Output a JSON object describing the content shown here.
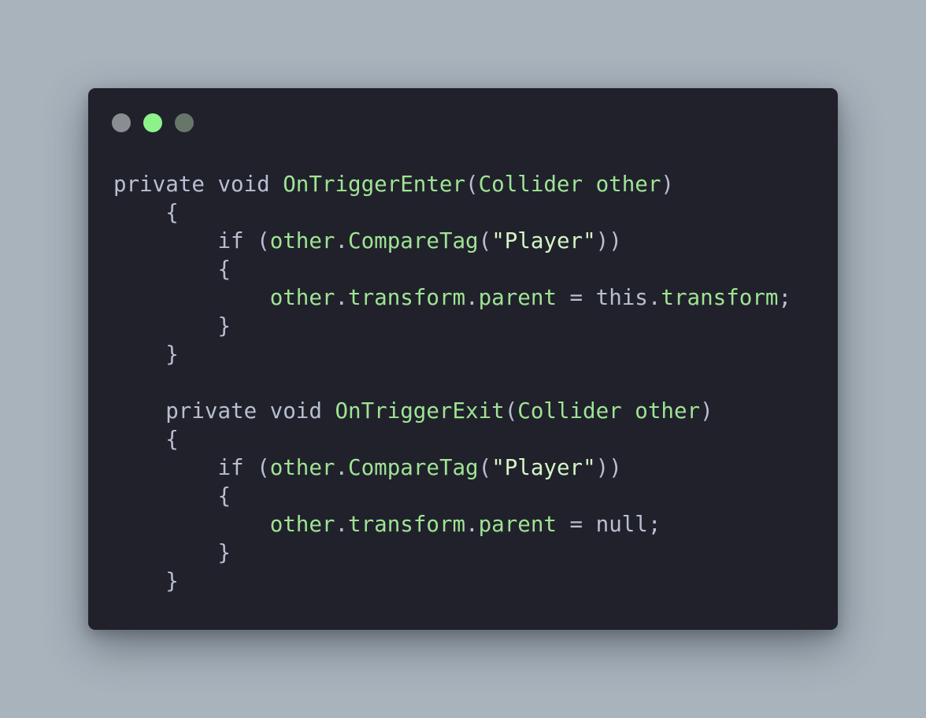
{
  "window": {
    "dots": [
      {
        "name": "close",
        "color": "#8a8d91"
      },
      {
        "name": "minimize",
        "color": "#8ef28b"
      },
      {
        "name": "zoom",
        "color": "#66776a"
      }
    ]
  },
  "code": {
    "lines": [
      [
        {
          "t": "private void ",
          "k": "text"
        },
        {
          "t": "OnTriggerEnter",
          "k": "green"
        },
        {
          "t": "(",
          "k": "text"
        },
        {
          "t": "Collider other",
          "k": "green"
        },
        {
          "t": ")",
          "k": "text"
        }
      ],
      [
        {
          "t": "    {",
          "k": "text"
        }
      ],
      [
        {
          "t": "        if (",
          "k": "text"
        },
        {
          "t": "other",
          "k": "green"
        },
        {
          "t": ".",
          "k": "text"
        },
        {
          "t": "CompareTag",
          "k": "green"
        },
        {
          "t": "(",
          "k": "text"
        },
        {
          "t": "\"Player\"",
          "k": "string"
        },
        {
          "t": "))",
          "k": "text"
        }
      ],
      [
        {
          "t": "        {",
          "k": "text"
        }
      ],
      [
        {
          "t": "            ",
          "k": "text"
        },
        {
          "t": "other",
          "k": "green"
        },
        {
          "t": ".",
          "k": "text"
        },
        {
          "t": "transform",
          "k": "green"
        },
        {
          "t": ".",
          "k": "text"
        },
        {
          "t": "parent",
          "k": "green"
        },
        {
          "t": " = this.",
          "k": "text"
        },
        {
          "t": "transform",
          "k": "green"
        },
        {
          "t": ";",
          "k": "text"
        }
      ],
      [
        {
          "t": "        }",
          "k": "text"
        }
      ],
      [
        {
          "t": "    }",
          "k": "text"
        }
      ],
      [
        {
          "t": "",
          "k": "text"
        }
      ],
      [
        {
          "t": "    private void ",
          "k": "text"
        },
        {
          "t": "OnTriggerExit",
          "k": "green"
        },
        {
          "t": "(",
          "k": "text"
        },
        {
          "t": "Collider other",
          "k": "green"
        },
        {
          "t": ")",
          "k": "text"
        }
      ],
      [
        {
          "t": "    {",
          "k": "text"
        }
      ],
      [
        {
          "t": "        if (",
          "k": "text"
        },
        {
          "t": "other",
          "k": "green"
        },
        {
          "t": ".",
          "k": "text"
        },
        {
          "t": "CompareTag",
          "k": "green"
        },
        {
          "t": "(",
          "k": "text"
        },
        {
          "t": "\"Player\"",
          "k": "string"
        },
        {
          "t": "))",
          "k": "text"
        }
      ],
      [
        {
          "t": "        {",
          "k": "text"
        }
      ],
      [
        {
          "t": "            ",
          "k": "text"
        },
        {
          "t": "other",
          "k": "green"
        },
        {
          "t": ".",
          "k": "text"
        },
        {
          "t": "transform",
          "k": "green"
        },
        {
          "t": ".",
          "k": "text"
        },
        {
          "t": "parent",
          "k": "green"
        },
        {
          "t": " = null;",
          "k": "text"
        }
      ],
      [
        {
          "t": "        }",
          "k": "text"
        }
      ],
      [
        {
          "t": "    }",
          "k": "text"
        }
      ]
    ]
  }
}
